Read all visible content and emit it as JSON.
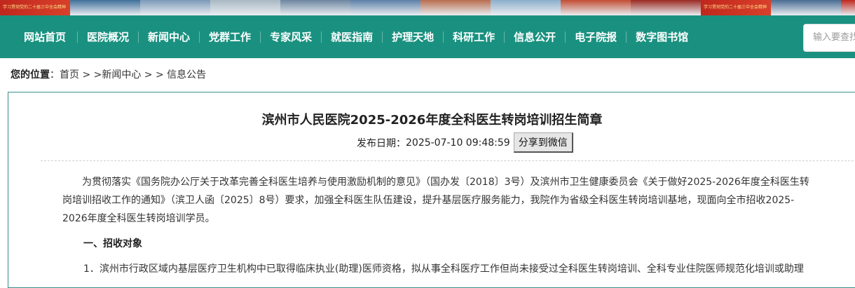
{
  "banner": {
    "slogan": "学习贯彻党的二十届三中全会精神",
    "segments": [
      "#c0271d",
      "#3f6f9a",
      "#7c99b8",
      "#a9b8c3",
      "#6d86a0",
      "#5c7fa8",
      "#b86d4e",
      "#8caecb",
      "#c34d34",
      "#9a2a22",
      "#5a7ea7",
      "#4a6c93",
      "#c0271d"
    ]
  },
  "nav": {
    "items": [
      "网站首页",
      "医院概况",
      "新闻中心",
      "党群工作",
      "专家风采",
      "就医指南",
      "护理天地",
      "科研工作",
      "信息公开",
      "电子院报",
      "数字图书馆"
    ],
    "search_placeholder": "输入要查找"
  },
  "breadcrumb": {
    "label": "您的位置",
    "path": "：首页 > >新闻中心 > > 信息公告"
  },
  "article": {
    "title": "滨州市人民医院2025-2026年度全科医生转岗培训招生简章",
    "date_label": "发布日期：",
    "date": "2025-07-10 09:48:59",
    "share_label": "分享到微信",
    "para_line1": "为贯彻落实《国务院办公厅关于改革完善全科医生培养与使用激励机制的意见》（国办发〔2018〕3号）及滨州市卫生健康委员会《关于做好2025-2026年度全科医生转",
    "para_line2": "岗培训招收工作的通知》（滨卫人函〔2025〕8号）要求，加强全科医生队伍建设，提升基层医疗服务能力，我院作为省级全科医生转岗培训基地，现面向全市招收2025-",
    "para_line3": "2026年度全科医生转岗培训学员。",
    "section1": "一、招收对象",
    "item1": "1．滨州市行政区域内基层医疗卫生机构中已取得临床执业(助理)医师资格，拟从事全科医疗工作但尚未接受过全科医生转岗培训、全科专业住院医师规范化培训或助理"
  },
  "colors": {
    "nav_bg": "#1a9180",
    "panel_border": "#3a8f88"
  }
}
